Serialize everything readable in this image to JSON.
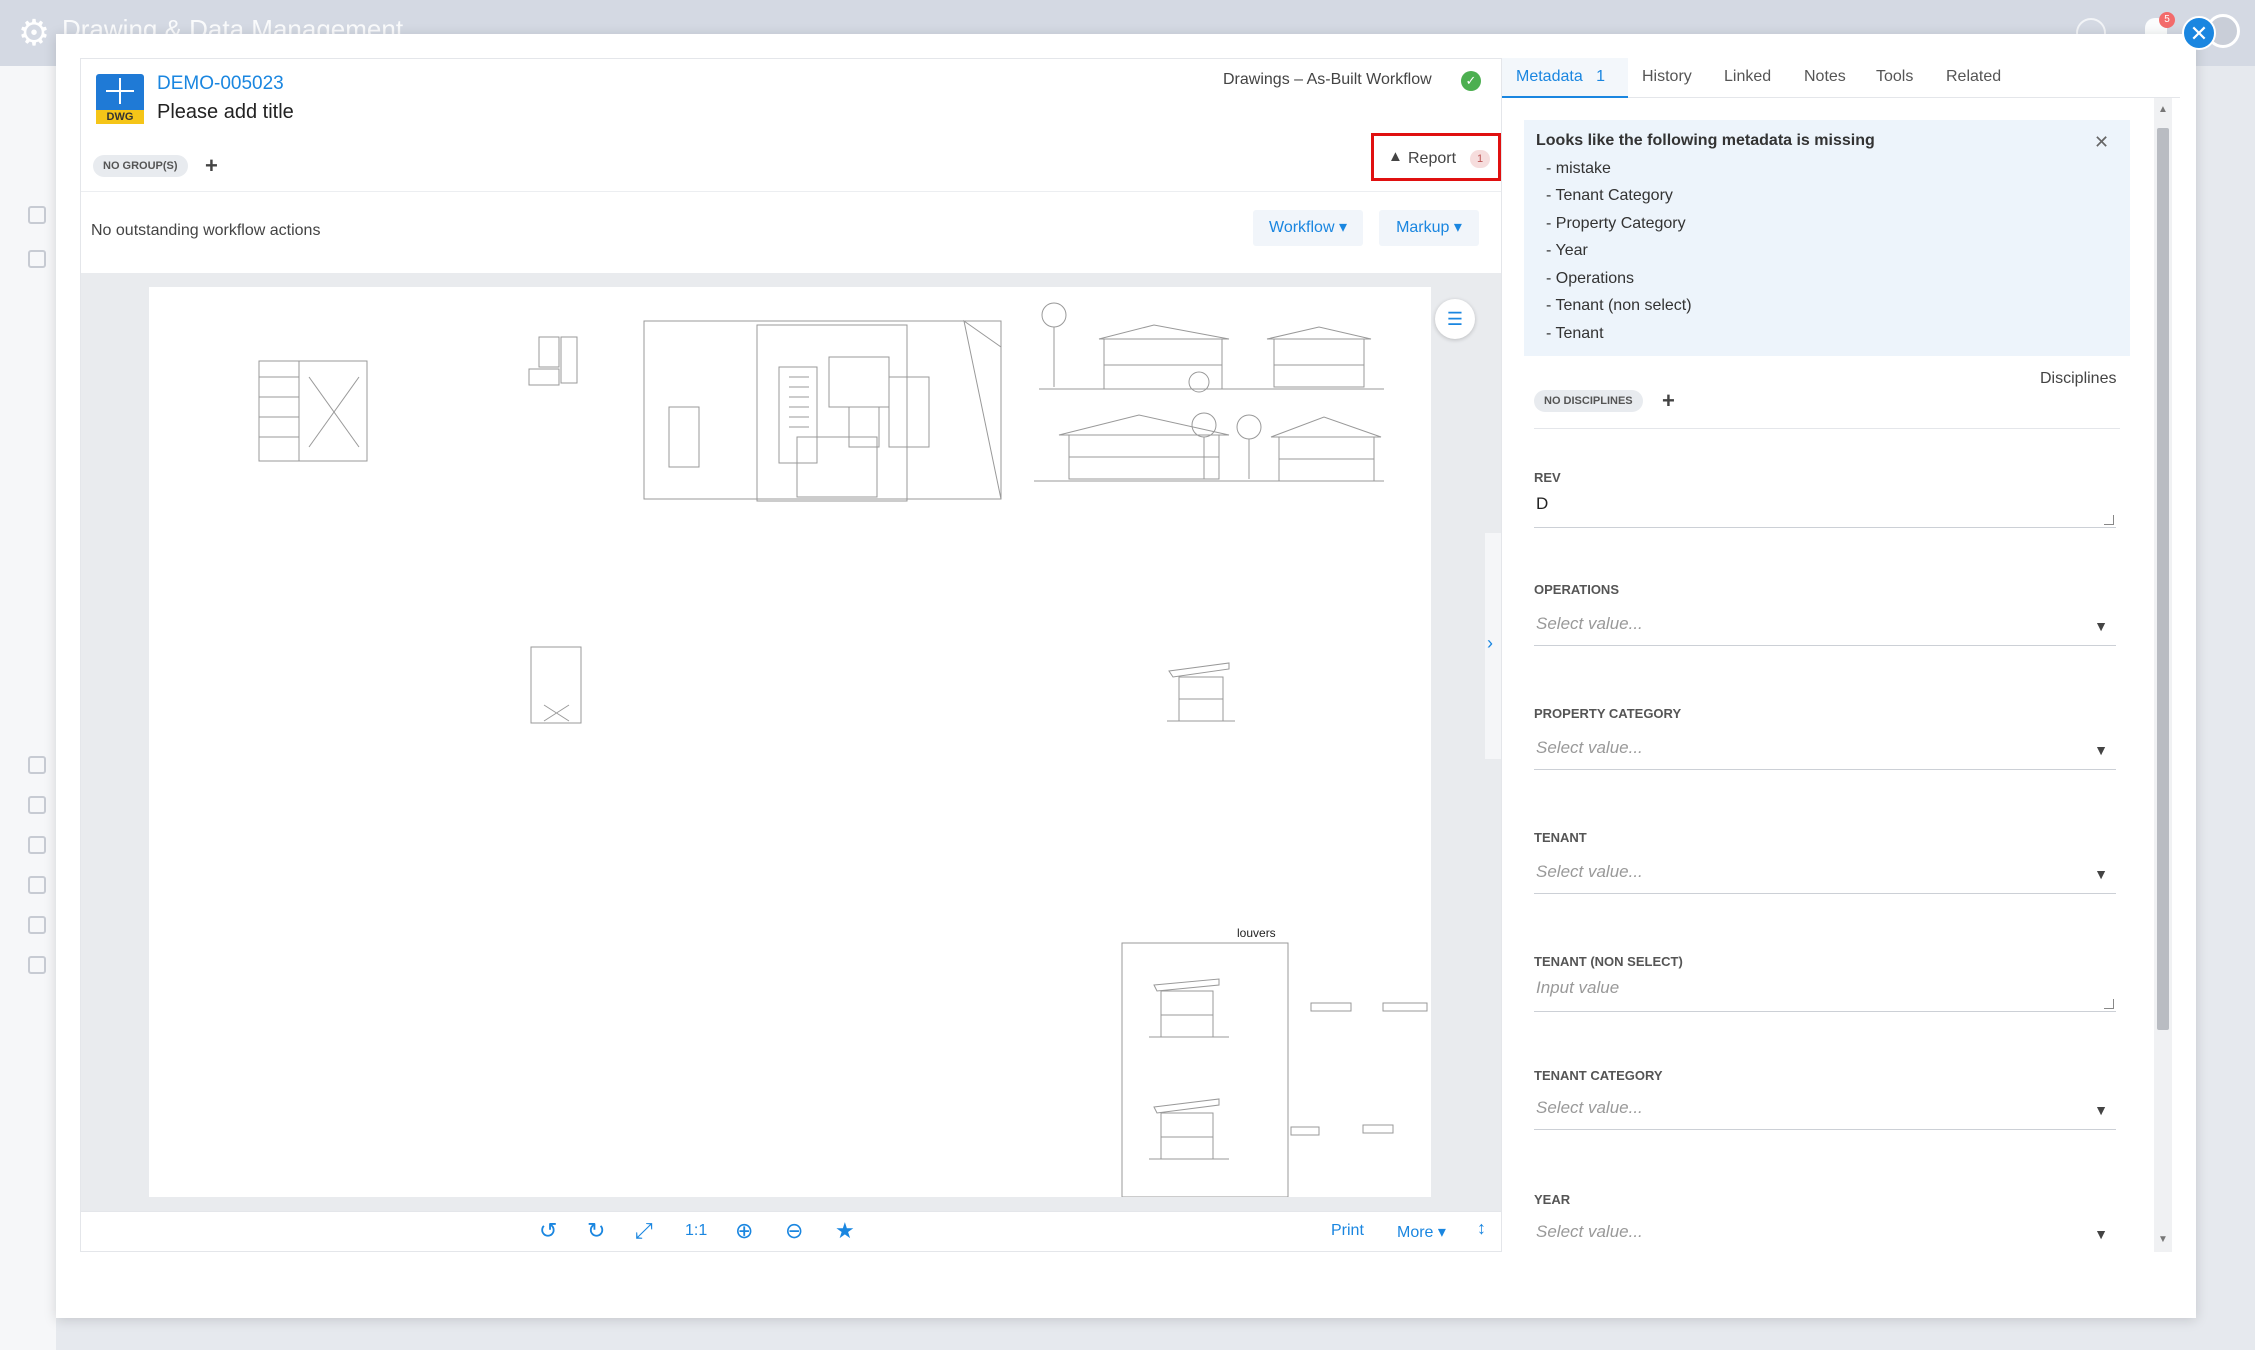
{
  "app": {
    "title": "Drawing & Data Management"
  },
  "notifications": {
    "count": "5"
  },
  "document": {
    "file_ext": "DWG",
    "id": "DEMO-005023",
    "title": "Please add title",
    "workflow": "Drawings – As-Built Workflow",
    "groups_badge": "NO GROUP(S)",
    "report_label": "Report",
    "report_count": "1",
    "actions_text": "No outstanding workflow actions",
    "workflow_btn": "Workflow ▾",
    "markup_btn": "Markup ▾"
  },
  "drawing": {
    "annotation": "louvers"
  },
  "toolbar": {
    "scale_label": "1:1",
    "print_label": "Print",
    "more_label": "More ▾"
  },
  "panel": {
    "tabs": [
      {
        "label": "Metadata"
      },
      {
        "label": "History"
      },
      {
        "label": "Linked"
      },
      {
        "label": "Notes"
      },
      {
        "label": "Tools"
      },
      {
        "label": "Related"
      }
    ],
    "metadata_count": "1",
    "alert": {
      "title": "Looks like the following metadata is missing",
      "items": [
        "- mistake",
        "- Tenant Category",
        "- Property Category",
        "- Year",
        "- Operations",
        "- Tenant (non select)",
        "- Tenant"
      ]
    },
    "disciplines_label": "Disciplines",
    "disciplines_badge": "NO DISCIPLINES",
    "fields": {
      "rev_label": "REV",
      "rev_value": "D",
      "operations_label": "OPERATIONS",
      "property_category_label": "PROPERTY CATEGORY",
      "tenant_label": "TENANT",
      "tenant_non_select_label": "TENANT (NON SELECT)",
      "tenant_category_label": "TENANT CATEGORY",
      "year_label": "YEAR",
      "select_placeholder": "Select value...",
      "input_placeholder": "Input value"
    }
  },
  "colors": {
    "accent": "#1a86e0",
    "report_highlight": "#e01010",
    "success": "#4caf50"
  }
}
